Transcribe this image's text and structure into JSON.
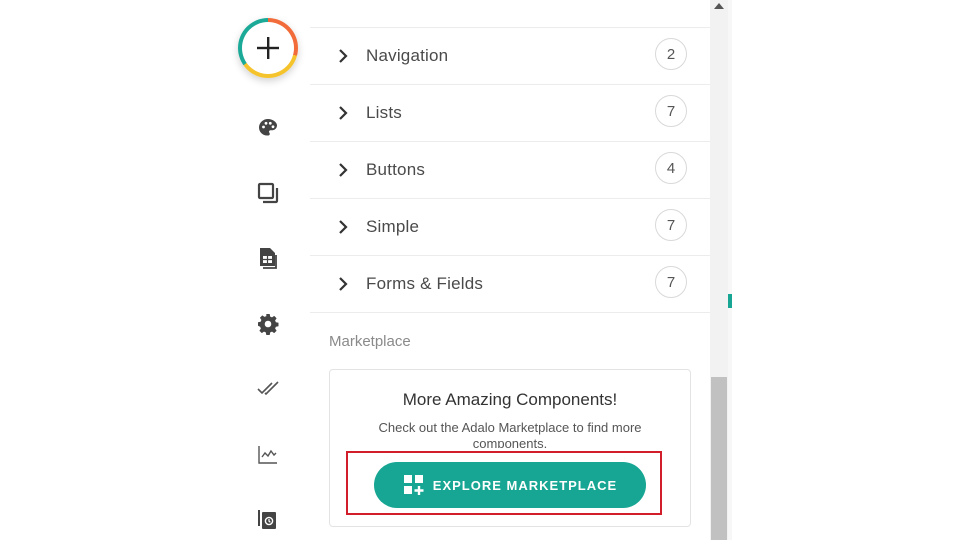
{
  "colors": {
    "accent": "#17a693",
    "highlight": "#d11e2a"
  },
  "rail": {
    "add_button": {
      "icon": "plus-icon"
    },
    "items": [
      {
        "name": "palette-icon"
      },
      {
        "name": "screens-icon"
      },
      {
        "name": "database-icon"
      },
      {
        "name": "settings-icon"
      },
      {
        "name": "publish-check-icon"
      },
      {
        "name": "analytics-icon"
      },
      {
        "name": "versions-icon"
      }
    ]
  },
  "categories": [
    {
      "label": "Navigation",
      "count": "2"
    },
    {
      "label": "Lists",
      "count": "7"
    },
    {
      "label": "Buttons",
      "count": "4"
    },
    {
      "label": "Simple",
      "count": "7"
    },
    {
      "label": "Forms & Fields",
      "count": "7"
    }
  ],
  "marketplace": {
    "heading": "Marketplace",
    "card_title": "More Amazing Components!",
    "card_desc": "Check out the Adalo Marketplace to find more components.",
    "button_label": "EXPLORE MARKETPLACE"
  }
}
